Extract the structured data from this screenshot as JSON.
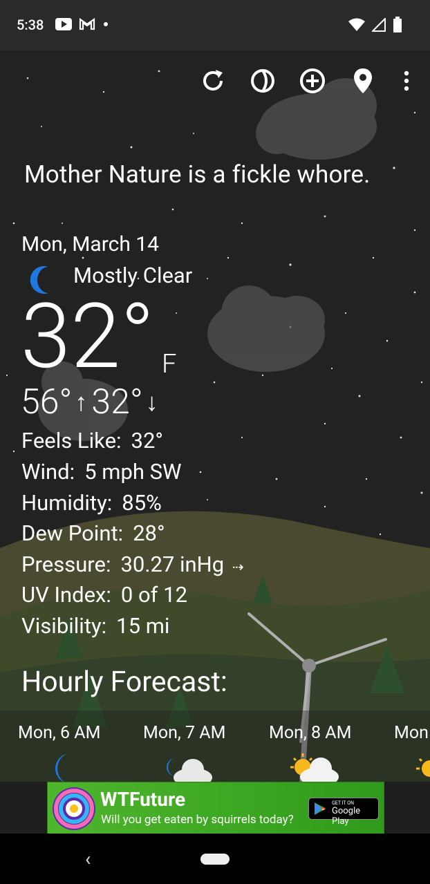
{
  "status_bar": {
    "time": "5:38",
    "icons_left": [
      "youtube-icon",
      "gmail-icon",
      "dot-icon"
    ],
    "icons_right": [
      "wifi-icon",
      "signal-icon",
      "battery-icon"
    ]
  },
  "toolbar": {
    "icons": [
      "refresh-icon",
      "theme-icon",
      "add-location-icon",
      "location-pin-icon",
      "overflow-menu-icon"
    ]
  },
  "quote": "Mother Nature is a fickle whore.",
  "weather": {
    "date": "Mon, March 14",
    "condition": "Mostly Clear",
    "temperature": "32°",
    "unit": "F",
    "high": "56°",
    "low": "32°"
  },
  "details": [
    {
      "label": "Feels Like:",
      "value": "32°"
    },
    {
      "label": "Wind:",
      "value": "5 mph SW"
    },
    {
      "label": "Humidity:",
      "value": "85%"
    },
    {
      "label": "Dew Point:",
      "value": "28°"
    },
    {
      "label": "Pressure:",
      "value": "30.27 inHg"
    },
    {
      "label": "UV Index:",
      "value": "0 of 12"
    },
    {
      "label": "Visibility:",
      "value": "15 mi"
    }
  ],
  "hourly": {
    "title": "Hourly Forecast:",
    "items": [
      {
        "label": "Mon, 6 AM",
        "icon": "moon-icon"
      },
      {
        "label": "Mon, 7 AM",
        "icon": "moon-cloud-icon"
      },
      {
        "label": "Mon, 8 AM",
        "icon": "sun-cloud-icon"
      },
      {
        "label": "Mon",
        "icon": "sun-icon"
      }
    ]
  },
  "ad": {
    "title": "WTFuture",
    "subtitle": "Will you get eaten by squirrels today?",
    "store_small": "GET IT ON",
    "store_big": "Google Play"
  },
  "colors": {
    "background": "#222222",
    "ad_green": "#3fa824",
    "moon_blue": "#1e78e0"
  }
}
